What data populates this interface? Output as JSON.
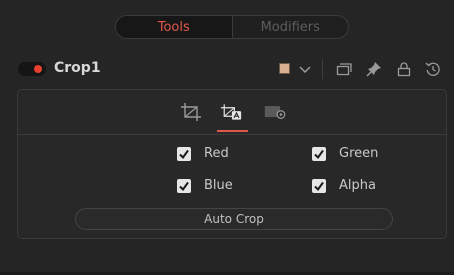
{
  "tabs": [
    {
      "label": "Tools",
      "active": true
    },
    {
      "label": "Modifiers",
      "active": false
    }
  ],
  "header": {
    "tool_name": "Crop1",
    "enabled": true,
    "swatch_color": "#d8b090",
    "icons": [
      "color-swatch-icon",
      "chevron-down-icon",
      "versions-icon",
      "pin-icon",
      "lock-icon",
      "reset-icon"
    ]
  },
  "content": {
    "tool_tabs": [
      {
        "name": "crop-icon",
        "active": false
      },
      {
        "name": "auto-crop-icon",
        "active": true
      },
      {
        "name": "settings-icon",
        "active": false
      }
    ],
    "channels": [
      {
        "label": "Red",
        "checked": true
      },
      {
        "label": "Green",
        "checked": true
      },
      {
        "label": "Blue",
        "checked": true
      },
      {
        "label": "Alpha",
        "checked": true
      }
    ],
    "auto_crop_label": "Auto Crop"
  },
  "colors": {
    "accent": "#e0584a",
    "toggle_on": "#e8402f",
    "background": "#252525"
  }
}
